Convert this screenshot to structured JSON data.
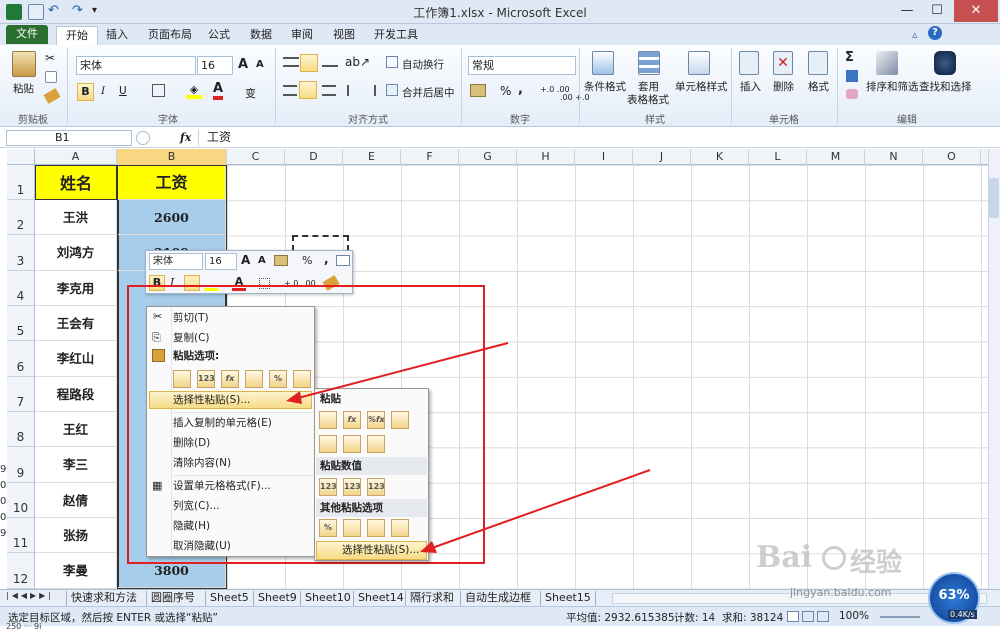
{
  "window": {
    "title": "工作簿1.xlsx - Microsoft Excel",
    "minimize": "—",
    "maximize": "☐",
    "close": "✕"
  },
  "tabs": [
    "文件",
    "开始",
    "插入",
    "页面布局",
    "公式",
    "数据",
    "审阅",
    "视图",
    "开发工具"
  ],
  "ribbon": {
    "clipboard": {
      "paste": "粘贴",
      "label": "剪贴板"
    },
    "font": {
      "name": "宋体",
      "size": "16",
      "bold": "B",
      "italic": "I",
      "underline": "U",
      "label": "字体",
      "grow": "A",
      "shrink": "A",
      "fill": "A"
    },
    "align": {
      "wrap": "自动换行",
      "merge": "合并后居中",
      "label": "对齐方式"
    },
    "number": {
      "format": "常规",
      "percent": "%",
      "comma": ",",
      "label": "数字",
      "inc": "+.0 .00",
      "dec": ".00 +.0"
    },
    "styles": {
      "cond": "条件格式",
      "table1": "套用",
      "table2": "表格格式",
      "cell": "单元格样式",
      "label": "样式"
    },
    "cells": {
      "insert": "插入",
      "delete": "删除",
      "format": "格式",
      "label": "单元格"
    },
    "editing": {
      "sum": "Σ",
      "sort": "排序和筛选",
      "find": "查找和选择",
      "label": "编辑"
    }
  },
  "formula": {
    "namebox": "B1",
    "fx": "fx",
    "content": "工资"
  },
  "columns": [
    "A",
    "B",
    "C",
    "D",
    "E",
    "F",
    "G",
    "H",
    "I",
    "J",
    "K",
    "L",
    "M",
    "N",
    "O"
  ],
  "rows": [
    "1",
    "2",
    "3",
    "4",
    "5",
    "6",
    "7",
    "8",
    "9",
    "10",
    "11",
    "12"
  ],
  "colA": [
    "姓名",
    "王洪",
    "刘鸿方",
    "李克用",
    "王会有",
    "李红山",
    "程路段",
    "王红",
    "李三",
    "赵倩",
    "张扬",
    "李曼"
  ],
  "colB": [
    "工资",
    "2600",
    "2100",
    "",
    "",
    "",
    "",
    "",
    "",
    "",
    "",
    "3800"
  ],
  "mini": {
    "font": "宋体",
    "size": "16",
    "grow": "A",
    "shrink": "A",
    "percent": "%",
    "comma": ",",
    "bold": "B",
    "italic": "I"
  },
  "context_menu": [
    {
      "label": "剪切(T)",
      "icon": "✂"
    },
    {
      "label": "复制(C)",
      "icon": "⎘"
    },
    {
      "label": "粘贴选项:",
      "icon": "📋"
    },
    {
      "label": "选择性粘贴(S)...",
      "icon": ""
    },
    {
      "label": "插入复制的单元格(E)",
      "icon": ""
    },
    {
      "label": "删除(D)",
      "icon": ""
    },
    {
      "label": "清除内容(N)",
      "icon": ""
    },
    {
      "label": "设置单元格格式(F)...",
      "icon": "▦"
    },
    {
      "label": "列宽(C)...",
      "icon": ""
    },
    {
      "label": "隐藏(H)",
      "icon": ""
    },
    {
      "label": "取消隐藏(U)",
      "icon": ""
    }
  ],
  "paste_icons": [
    "",
    "123",
    "fx",
    "",
    "%",
    ""
  ],
  "submenu": {
    "h1": "粘贴",
    "h2": "粘贴数值",
    "h3": "其他粘贴选项",
    "item": "选择性粘贴(S)...",
    "row1": [
      "",
      "fx",
      "%fx",
      ""
    ],
    "row2": [
      "",
      "",
      ""
    ],
    "row3": [
      "123",
      "123",
      "123"
    ],
    "row4": [
      "%",
      "",
      "",
      ""
    ]
  },
  "sheets": [
    "快速求和方法",
    "圆圈序号",
    "Sheet5",
    "Sheet9",
    "Sheet10",
    "Sheet14",
    "隔行求和",
    "自动生成边框",
    "Sheet15"
  ],
  "status": {
    "msg": "选定目标区域，然后按 ENTER 或选择“粘贴”",
    "avg": "平均值: 2932.615385",
    "count": "计数: 14",
    "sum": "求和: 38124",
    "zoom": "100%",
    "badge": "63%",
    "speed": "0.4K/s"
  },
  "watermark": {
    "brand": "Bai",
    "brand2": "经验",
    "url": "jingyan.baidu.com"
  },
  "left_edge": [
    "9",
    "0",
    "0",
    "0",
    "9"
  ],
  "bottom_edge": "250 ··· 9i",
  "colors": {
    "yellow": "#ffff00",
    "blue": "#a6cdea",
    "red": "#e02020",
    "header": "#f0f3f8"
  }
}
